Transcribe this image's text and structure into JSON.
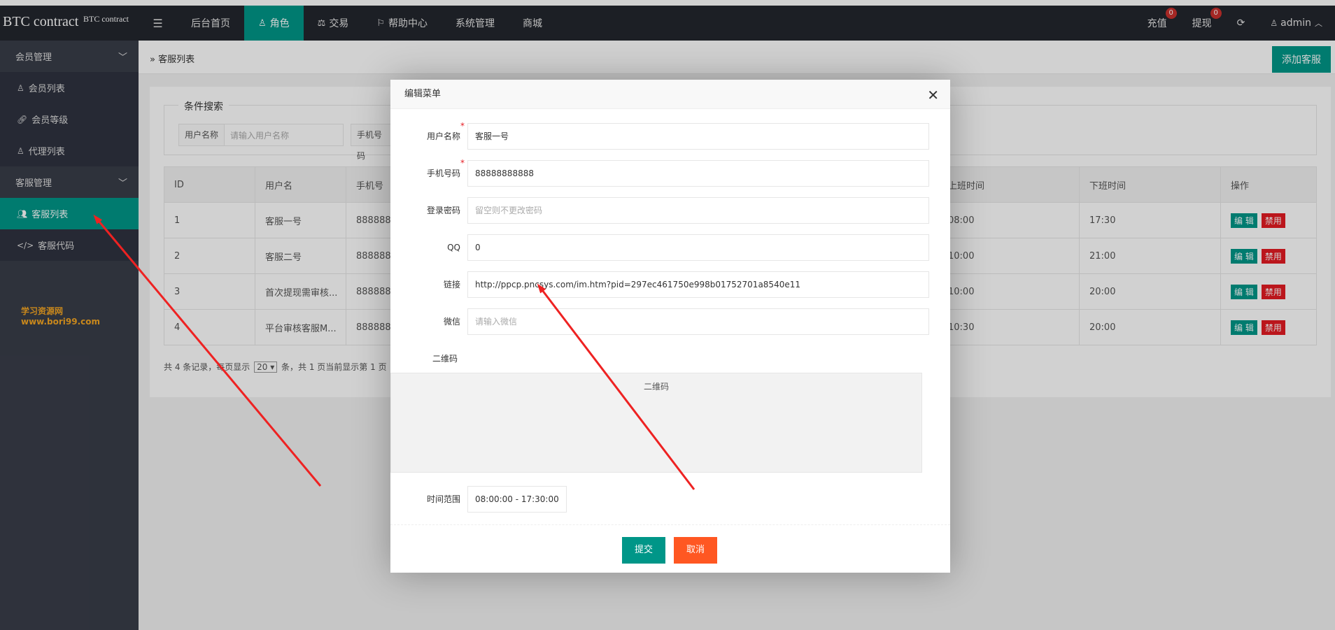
{
  "app": {
    "title": "BTC contract",
    "subtitle": "BTC contract"
  },
  "header": {
    "nav": [
      {
        "label": "后台首页",
        "icon": ""
      },
      {
        "label": "角色",
        "icon": "user-icon"
      },
      {
        "label": "交易",
        "icon": "balance-scale-icon"
      },
      {
        "label": "帮助中心",
        "icon": "flag-icon"
      },
      {
        "label": "系统管理",
        "icon": ""
      },
      {
        "label": "商城",
        "icon": ""
      }
    ],
    "recharge": {
      "label": "充值",
      "count": "0"
    },
    "withdraw": {
      "label": "提现",
      "count": "0"
    },
    "user": "admin"
  },
  "sidebar": {
    "groups": [
      {
        "label": "会员管理",
        "items": [
          {
            "label": "会员列表",
            "icon": "user-icon"
          },
          {
            "label": "会员等级",
            "icon": "link-icon"
          },
          {
            "label": "代理列表",
            "icon": "user-icon"
          }
        ]
      },
      {
        "label": "客服管理",
        "items": [
          {
            "label": "客服列表",
            "icon": "users-icon"
          },
          {
            "label": "客服代码",
            "icon": "code-icon"
          }
        ]
      }
    ],
    "watermark": "学习资源网www.bori99.com"
  },
  "page": {
    "breadcrumb": "客服列表",
    "add_button": "添加客服",
    "search": {
      "legend": "条件搜索",
      "user_label": "用户名称",
      "user_placeholder": "请输入用户名称",
      "phone_label": "手机号码"
    },
    "table": {
      "headers": [
        "ID",
        "用户名",
        "手机号",
        "上班时间",
        "下班时间",
        "操作"
      ],
      "rows": [
        {
          "id": "1",
          "name": "客服一号",
          "phone": "8888888",
          "start": "08:00",
          "end": "17:30"
        },
        {
          "id": "2",
          "name": "客服二号",
          "phone": "8888888",
          "start": "10:00",
          "end": "21:00"
        },
        {
          "id": "3",
          "name": "首次提现需审核...",
          "phone": "8888888",
          "start": "10:00",
          "end": "20:00"
        },
        {
          "id": "4",
          "name": "平台审核客服M...",
          "phone": "8888888",
          "start": "10:30",
          "end": "20:00"
        }
      ],
      "edit_label": "编 辑",
      "ban_label": "禁用"
    },
    "pager": {
      "prefix": "共 4 条记录，每页显示",
      "page_size": "20",
      "suffix": "条，共 1 页当前显示第 1 页"
    }
  },
  "modal": {
    "title": "编辑菜单",
    "fields": {
      "username": {
        "label": "用户名称",
        "value": "客服一号"
      },
      "phone": {
        "label": "手机号码",
        "value": "88888888888"
      },
      "password": {
        "label": "登录密码",
        "placeholder": "留空则不更改密码"
      },
      "qq": {
        "label": "QQ",
        "value": "0"
      },
      "link": {
        "label": "链接",
        "value": "http://ppcp.pncsys.com/im.htm?pid=297ec461750e998b01752701a8540e11"
      },
      "wechat": {
        "label": "微信",
        "placeholder": "请输入微信"
      },
      "qrcode": {
        "label": "二维码",
        "header": "二维码"
      },
      "time": {
        "label": "时间范围",
        "value": "08:00:00 - 17:30:00"
      }
    },
    "submit": "提交",
    "cancel": "取消"
  },
  "colors": {
    "accent": "#009688",
    "header": "#23262e",
    "sidebar": "#393d49",
    "danger": "#e51c23",
    "cancel": "#ff5722",
    "annotation": "#ee2222"
  }
}
